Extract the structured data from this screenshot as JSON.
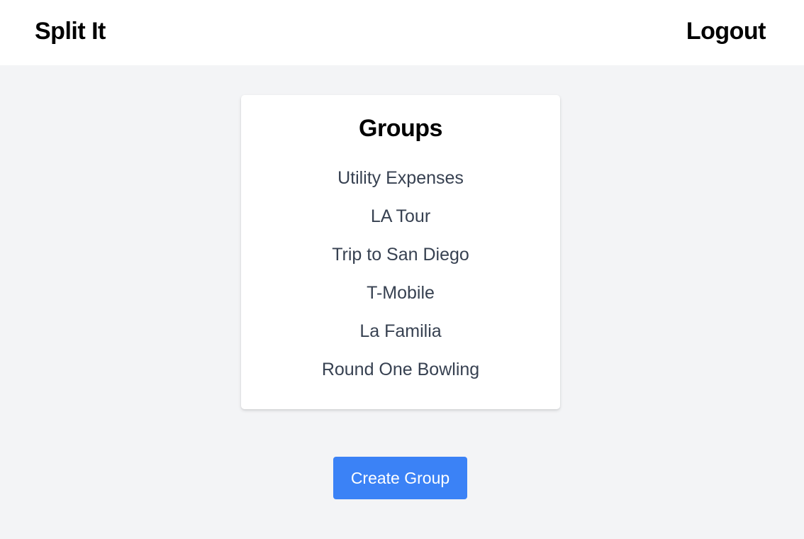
{
  "header": {
    "brand": "Split It",
    "logout_label": "Logout"
  },
  "groups": {
    "title": "Groups",
    "items": [
      {
        "label": "Utility Expenses"
      },
      {
        "label": "LA Tour"
      },
      {
        "label": "Trip to San Diego"
      },
      {
        "label": "T-Mobile"
      },
      {
        "label": "La Familia"
      },
      {
        "label": "Round One Bowling"
      }
    ]
  },
  "actions": {
    "create_group_label": "Create Group"
  },
  "colors": {
    "page_background": "#f3f4f6",
    "header_background": "#ffffff",
    "card_background": "#ffffff",
    "primary_button": "#3b82f6",
    "list_text": "#374151"
  }
}
